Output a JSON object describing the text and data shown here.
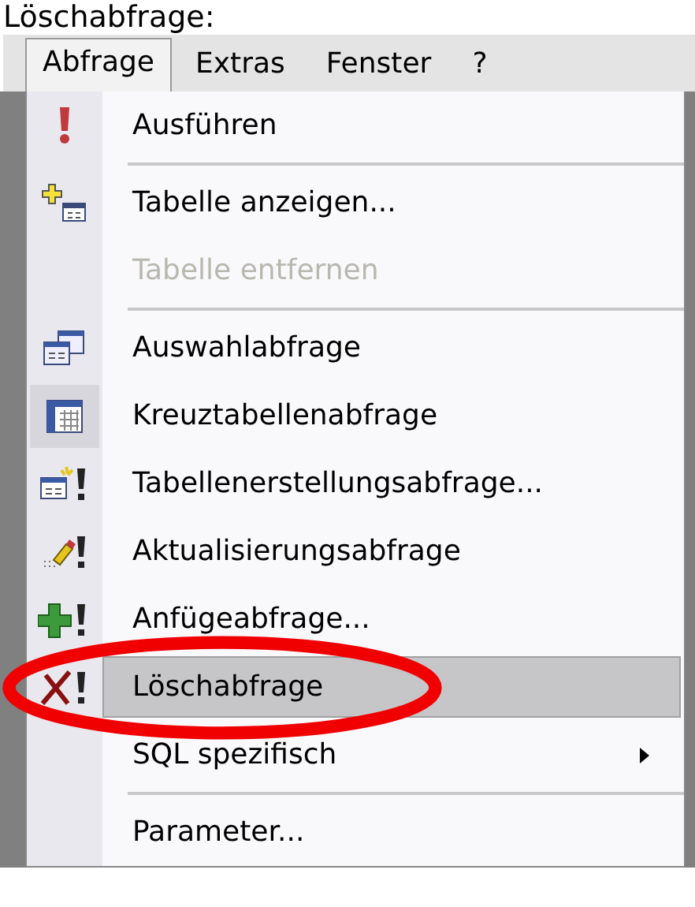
{
  "caption": "Löschabfrage:",
  "menubar": [
    {
      "label": "Abfrage",
      "selected": true
    },
    {
      "label": "Extras",
      "selected": false
    },
    {
      "label": "Fenster",
      "selected": false
    },
    {
      "label": "?",
      "selected": false
    }
  ],
  "menu": [
    {
      "kind": "command",
      "label": "Ausführen",
      "disabled": false,
      "checked": false,
      "selected": false
    },
    {
      "kind": "separator"
    },
    {
      "kind": "command",
      "label": "Tabelle anzeigen...",
      "disabled": false,
      "checked": false,
      "selected": false
    },
    {
      "kind": "command",
      "label": "Tabelle entfernen",
      "disabled": true,
      "checked": false,
      "selected": false
    },
    {
      "kind": "separator"
    },
    {
      "kind": "command",
      "label": "Auswahlabfrage",
      "disabled": false,
      "checked": false,
      "selected": false
    },
    {
      "kind": "command",
      "label": "Kreuztabellenabfrage",
      "disabled": false,
      "checked": true,
      "selected": false
    },
    {
      "kind": "command",
      "label": "Tabellenerstellungsabfrage...",
      "disabled": false,
      "checked": false,
      "selected": false
    },
    {
      "kind": "command",
      "label": "Aktualisierungsabfrage",
      "disabled": false,
      "checked": false,
      "selected": false
    },
    {
      "kind": "command",
      "label": "Anfügeabfrage...",
      "disabled": false,
      "checked": false,
      "selected": false
    },
    {
      "kind": "command",
      "label": "Löschabfrage",
      "disabled": false,
      "checked": false,
      "selected": true
    },
    {
      "kind": "submenu",
      "label": "SQL spezifisch",
      "disabled": false,
      "checked": false,
      "selected": false
    },
    {
      "kind": "separator"
    },
    {
      "kind": "command",
      "label": "Parameter...",
      "disabled": false,
      "checked": false,
      "selected": false
    }
  ]
}
